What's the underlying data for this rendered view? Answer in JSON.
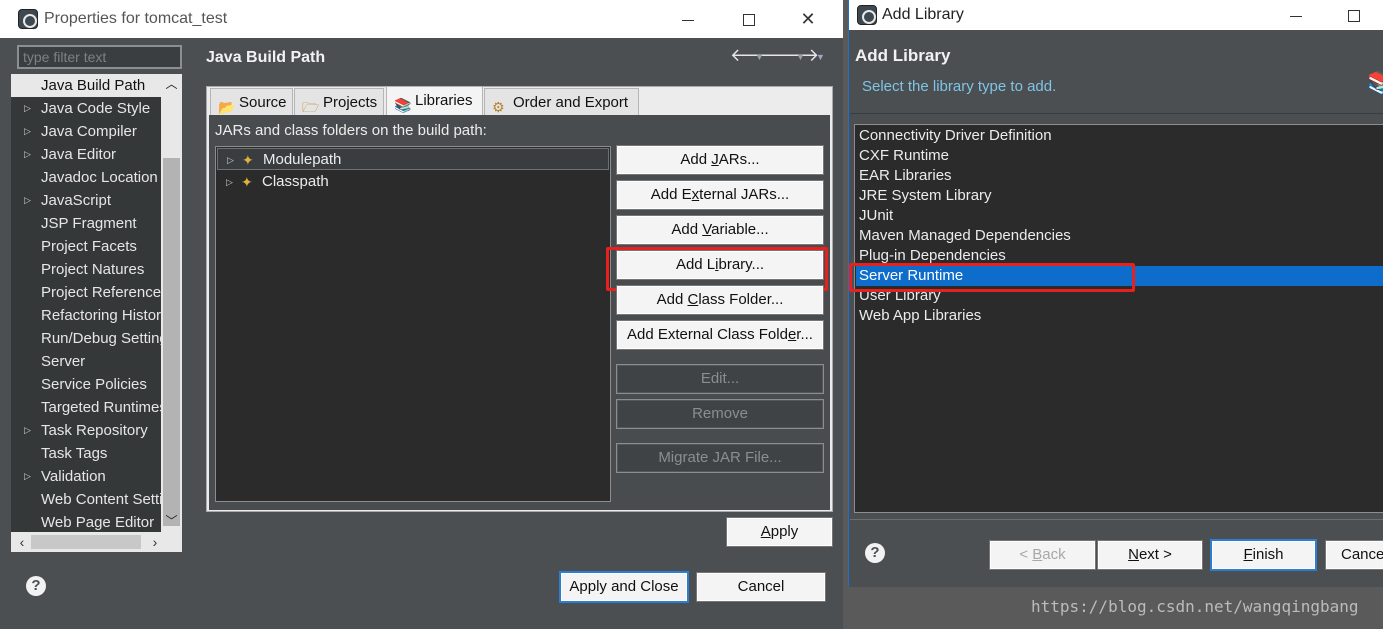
{
  "properties_window": {
    "title": "Properties for tomcat_test",
    "filter_placeholder": "type filter text",
    "nav_items": [
      {
        "label": "Java Build Path",
        "expandable": false,
        "selected": true
      },
      {
        "label": "Java Code Style",
        "expandable": true
      },
      {
        "label": "Java Compiler",
        "expandable": true
      },
      {
        "label": "Java Editor",
        "expandable": true
      },
      {
        "label": "Javadoc Location",
        "expandable": false
      },
      {
        "label": "JavaScript",
        "expandable": true
      },
      {
        "label": "JSP Fragment",
        "expandable": false
      },
      {
        "label": "Project Facets",
        "expandable": false
      },
      {
        "label": "Project Natures",
        "expandable": false
      },
      {
        "label": "Project References",
        "expandable": false
      },
      {
        "label": "Refactoring History",
        "expandable": false
      },
      {
        "label": "Run/Debug Settings",
        "expandable": false
      },
      {
        "label": "Server",
        "expandable": false
      },
      {
        "label": "Service Policies",
        "expandable": false
      },
      {
        "label": "Targeted Runtimes",
        "expandable": false
      },
      {
        "label": "Task Repository",
        "expandable": true
      },
      {
        "label": "Task Tags",
        "expandable": false
      },
      {
        "label": "Validation",
        "expandable": true
      },
      {
        "label": "Web Content Settings",
        "expandable": false
      },
      {
        "label": "Web Page Editor",
        "expandable": false
      }
    ],
    "page_title": "Java Build Path",
    "tabs": [
      {
        "label": "Source"
      },
      {
        "label": "Projects"
      },
      {
        "label": "Libraries",
        "active": true
      },
      {
        "label": "Order and Export"
      }
    ],
    "build_path_label": "JARs and class folders on the build path:",
    "tree_items": [
      {
        "label": "Modulepath"
      },
      {
        "label": "Classpath"
      }
    ],
    "buttons": {
      "add_jars": {
        "pre": "Add ",
        "u": "J",
        "post": "ARs..."
      },
      "add_external_jars": {
        "pre": "Add E",
        "u": "x",
        "post": "ternal JARs..."
      },
      "add_variable": {
        "pre": "Add ",
        "u": "V",
        "post": "ariable..."
      },
      "add_library": {
        "pre": "Add L",
        "u": "i",
        "post": "brary..."
      },
      "add_class_folder": {
        "pre": "Add ",
        "u": "C",
        "post": "lass Folder..."
      },
      "add_external_class_folder": {
        "pre": "Add External Class Fold",
        "u": "e",
        "post": "r..."
      },
      "edit": "Edit...",
      "remove": "Remove",
      "migrate_jar": "Migrate JAR File...",
      "apply": {
        "pre": "",
        "u": "A",
        "post": "pply"
      },
      "apply_and_close": "Apply and Close",
      "cancel": "Cancel"
    }
  },
  "add_library_window": {
    "title": "Add Library",
    "heading": "Add Library",
    "subtitle": "Select the library type to add.",
    "library_types": [
      "Connectivity Driver Definition",
      "CXF Runtime",
      "EAR Libraries",
      "JRE System Library",
      "JUnit",
      "Maven Managed Dependencies",
      "Plug-in Dependencies",
      "Server Runtime",
      "User Library",
      "Web App Libraries"
    ],
    "selected_index": 7,
    "buttons": {
      "back": {
        "pre": "< ",
        "u": "B",
        "post": "ack"
      },
      "next": {
        "pre": "",
        "u": "N",
        "post": "ext >"
      },
      "finish": {
        "pre": "",
        "u": "F",
        "post": "inish"
      },
      "cancel": "Cancel"
    }
  },
  "colors": {
    "highlight_box": "#e8201e",
    "selection": "#0e6dca",
    "dialog_bg": "#4b4f52"
  },
  "watermark": "https://blog.csdn.net/wangqingbang"
}
